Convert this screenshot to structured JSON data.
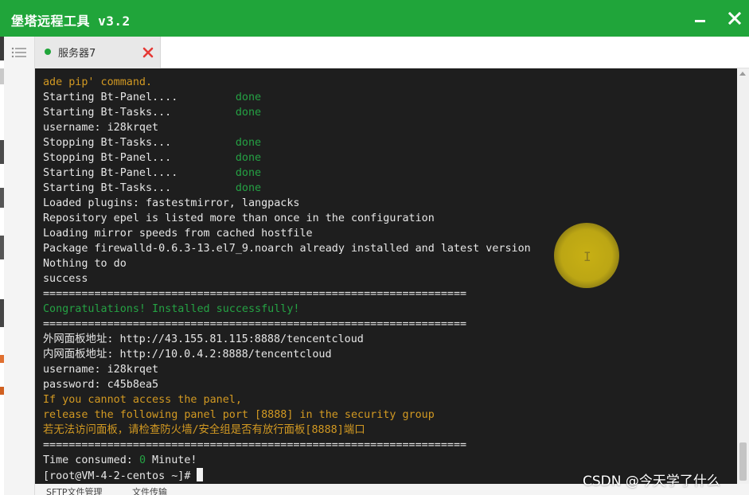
{
  "window": {
    "title": "堡塔远程工具 v3.2",
    "accent_color": "#20a53a",
    "minimize_icon": "minimize-icon",
    "close_icon": "close-icon"
  },
  "sidebar": {
    "menu_icon": "menu-icon"
  },
  "tab": {
    "label": "服务器7",
    "status_color": "#20a53a",
    "close_color": "#e53935"
  },
  "terminal": {
    "lines": [
      {
        "text": "ade pip' command.",
        "color": "orange"
      },
      {
        "text": "Starting Bt-Panel....",
        "status": "done"
      },
      {
        "text": "Starting Bt-Tasks...",
        "status": "done"
      },
      {
        "text": "username: i28krqet",
        "color": "white"
      },
      {
        "text": "Stopping Bt-Tasks...",
        "status": "done"
      },
      {
        "text": "Stopping Bt-Panel...",
        "status": "done"
      },
      {
        "text": "Starting Bt-Panel....",
        "status": "done"
      },
      {
        "text": "Starting Bt-Tasks...",
        "status": "done"
      },
      {
        "text": "Loaded plugins: fastestmirror, langpacks",
        "color": "white"
      },
      {
        "text": "Repository epel is listed more than once in the configuration",
        "color": "white"
      },
      {
        "text": "Loading mirror speeds from cached hostfile",
        "color": "white"
      },
      {
        "text": "Package firewalld-0.6.3-13.el7_9.noarch already installed and latest version",
        "color": "white"
      },
      {
        "text": "Nothing to do",
        "color": "white"
      },
      {
        "text": "success",
        "color": "white"
      },
      {
        "text": "==================================================================",
        "color": "white"
      },
      {
        "text": "Congratulations! Installed successfully!",
        "color": "green"
      },
      {
        "text": "==================================================================",
        "color": "white"
      },
      {
        "text": "外网面板地址: http://43.155.81.115:8888/tencentcloud",
        "color": "white"
      },
      {
        "text": "内网面板地址: http://10.0.4.2:8888/tencentcloud",
        "color": "white"
      },
      {
        "text": "username: i28krqet",
        "color": "white"
      },
      {
        "text": "password: c45b8ea5",
        "color": "white"
      },
      {
        "text": "If you cannot access the panel,",
        "color": "orange"
      },
      {
        "text": "release the following panel port [8888] in the security group",
        "color": "orange"
      },
      {
        "text": "若无法访问面板，请检查防火墙/安全组是否有放行面板[8888]端口",
        "color": "orange"
      },
      {
        "text": "==================================================================",
        "color": "white"
      },
      {
        "text": "Time consumed: ",
        "color": "white",
        "value": "0",
        "suffix": " Minute!"
      },
      {
        "text": "[root@VM-4-2-centos ~]# ",
        "color": "white",
        "prompt": true
      }
    ],
    "colors": {
      "orange": "#d29922",
      "green": "#25a244",
      "white": "#e6e6e6",
      "background": "#1e1e1e"
    }
  },
  "bottom_tabs": [
    "SFTP文件管理",
    "文件传输"
  ],
  "watermark": "CSDN @今天学了什么"
}
